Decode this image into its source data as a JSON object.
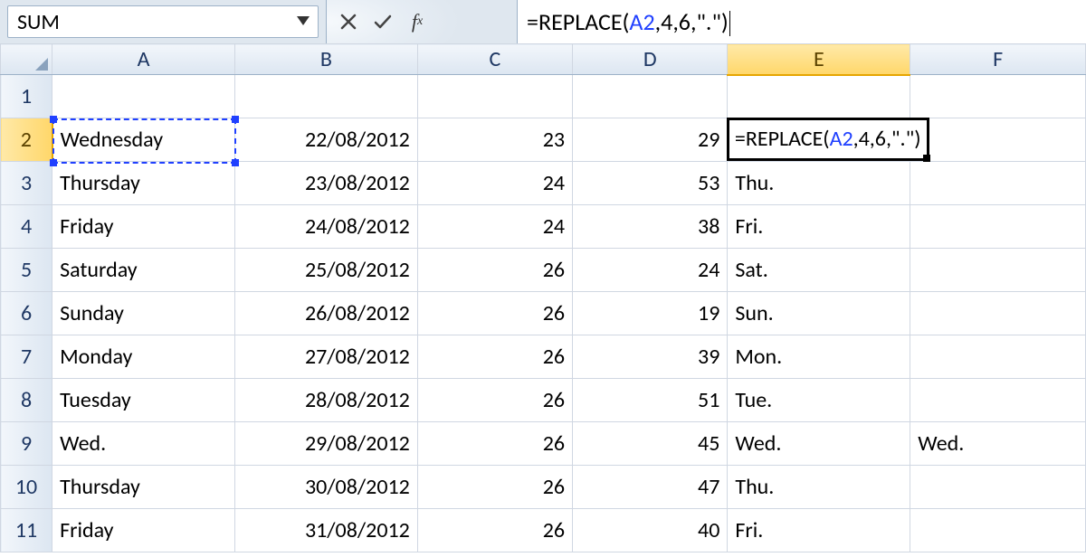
{
  "namebox": {
    "value": "SUM"
  },
  "formula_bar": {
    "prefix": "=REPLACE(",
    "ref": "A2",
    "suffix": ",4,6,\".\")"
  },
  "columns": [
    "A",
    "B",
    "C",
    "D",
    "E",
    "F"
  ],
  "active_col": "E",
  "active_row": 2,
  "editing_cell": {
    "prefix": "=REPLACE(",
    "ref": "A2",
    "suffix": ",4,6,\".\")"
  },
  "rows": [
    {
      "n": 1,
      "A": "",
      "B": "",
      "C": "",
      "D": "",
      "E": "",
      "F": ""
    },
    {
      "n": 2,
      "A": "Wednesday",
      "B": "22/08/2012",
      "C": "23",
      "D": "29",
      "E": "",
      "F": ""
    },
    {
      "n": 3,
      "A": "Thursday",
      "B": "23/08/2012",
      "C": "24",
      "D": "53",
      "E": "Thu.",
      "F": ""
    },
    {
      "n": 4,
      "A": "Friday",
      "B": "24/08/2012",
      "C": "24",
      "D": "38",
      "E": "Fri.",
      "F": ""
    },
    {
      "n": 5,
      "A": "Saturday",
      "B": "25/08/2012",
      "C": "26",
      "D": "24",
      "E": "Sat.",
      "F": ""
    },
    {
      "n": 6,
      "A": "Sunday",
      "B": "26/08/2012",
      "C": "26",
      "D": "19",
      "E": "Sun.",
      "F": ""
    },
    {
      "n": 7,
      "A": "Monday",
      "B": "27/08/2012",
      "C": "26",
      "D": "39",
      "E": "Mon.",
      "F": ""
    },
    {
      "n": 8,
      "A": "Tuesday",
      "B": "28/08/2012",
      "C": "26",
      "D": "51",
      "E": "Tue.",
      "F": ""
    },
    {
      "n": 9,
      "A": "Wed.",
      "B": "29/08/2012",
      "C": "26",
      "D": "45",
      "E": "Wed.",
      "F": "Wed."
    },
    {
      "n": 10,
      "A": "Thursday",
      "B": "30/08/2012",
      "C": "26",
      "D": "47",
      "E": "Thu.",
      "F": ""
    },
    {
      "n": 11,
      "A": "Friday",
      "B": "31/08/2012",
      "C": "26",
      "D": "40",
      "E": "Fri.",
      "F": ""
    }
  ]
}
